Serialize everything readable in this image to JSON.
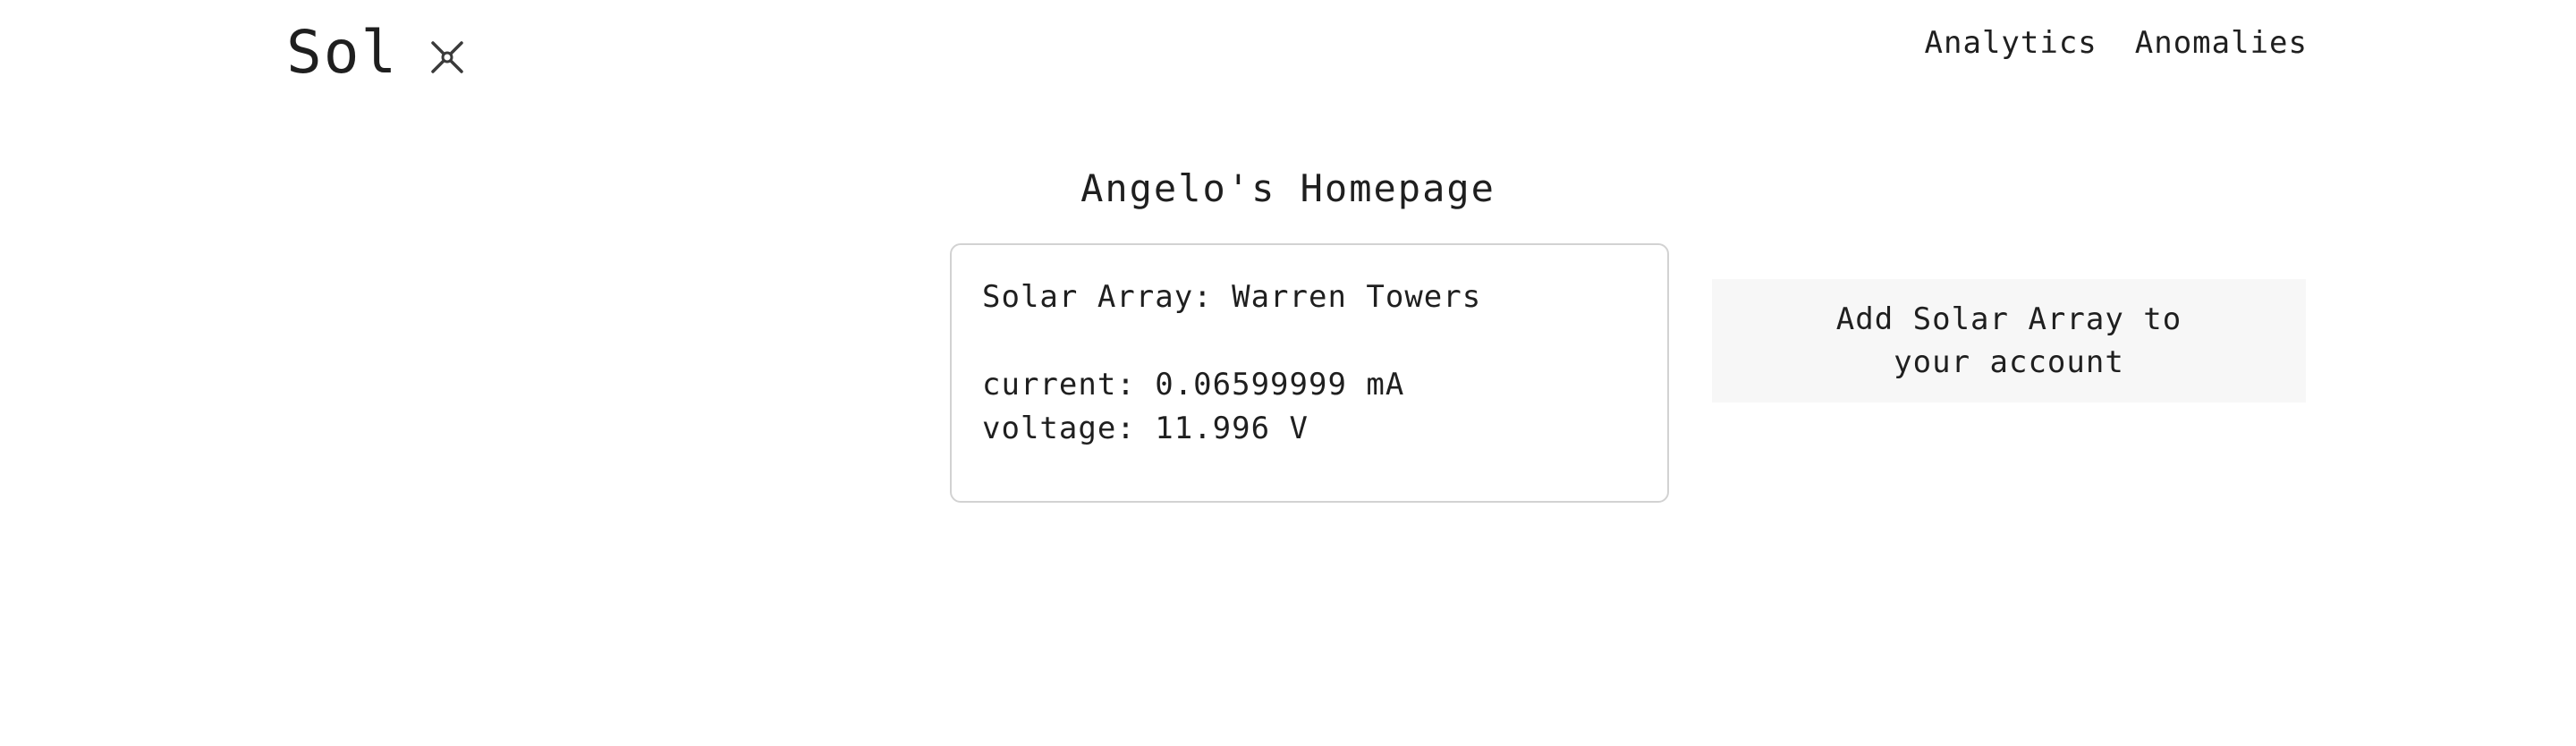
{
  "header": {
    "brand": "Sol",
    "brand_icon": "propeller-x-icon",
    "nav": {
      "analytics": "Analytics",
      "anomalies": "Anomalies"
    }
  },
  "main": {
    "title": "Angelo's Homepage",
    "array_card": {
      "name_line": "Solar Array: Warren Towers",
      "current_line": "current: 0.06599999 mA",
      "voltage_line": "voltage: 11.996 V"
    },
    "add_button_label": "Add Solar Array to your account"
  },
  "colors": {
    "text": "#1f1f1f",
    "card_border": "#d2d2d2",
    "button_bg": "#f7f7f7",
    "background": "#ffffff"
  }
}
